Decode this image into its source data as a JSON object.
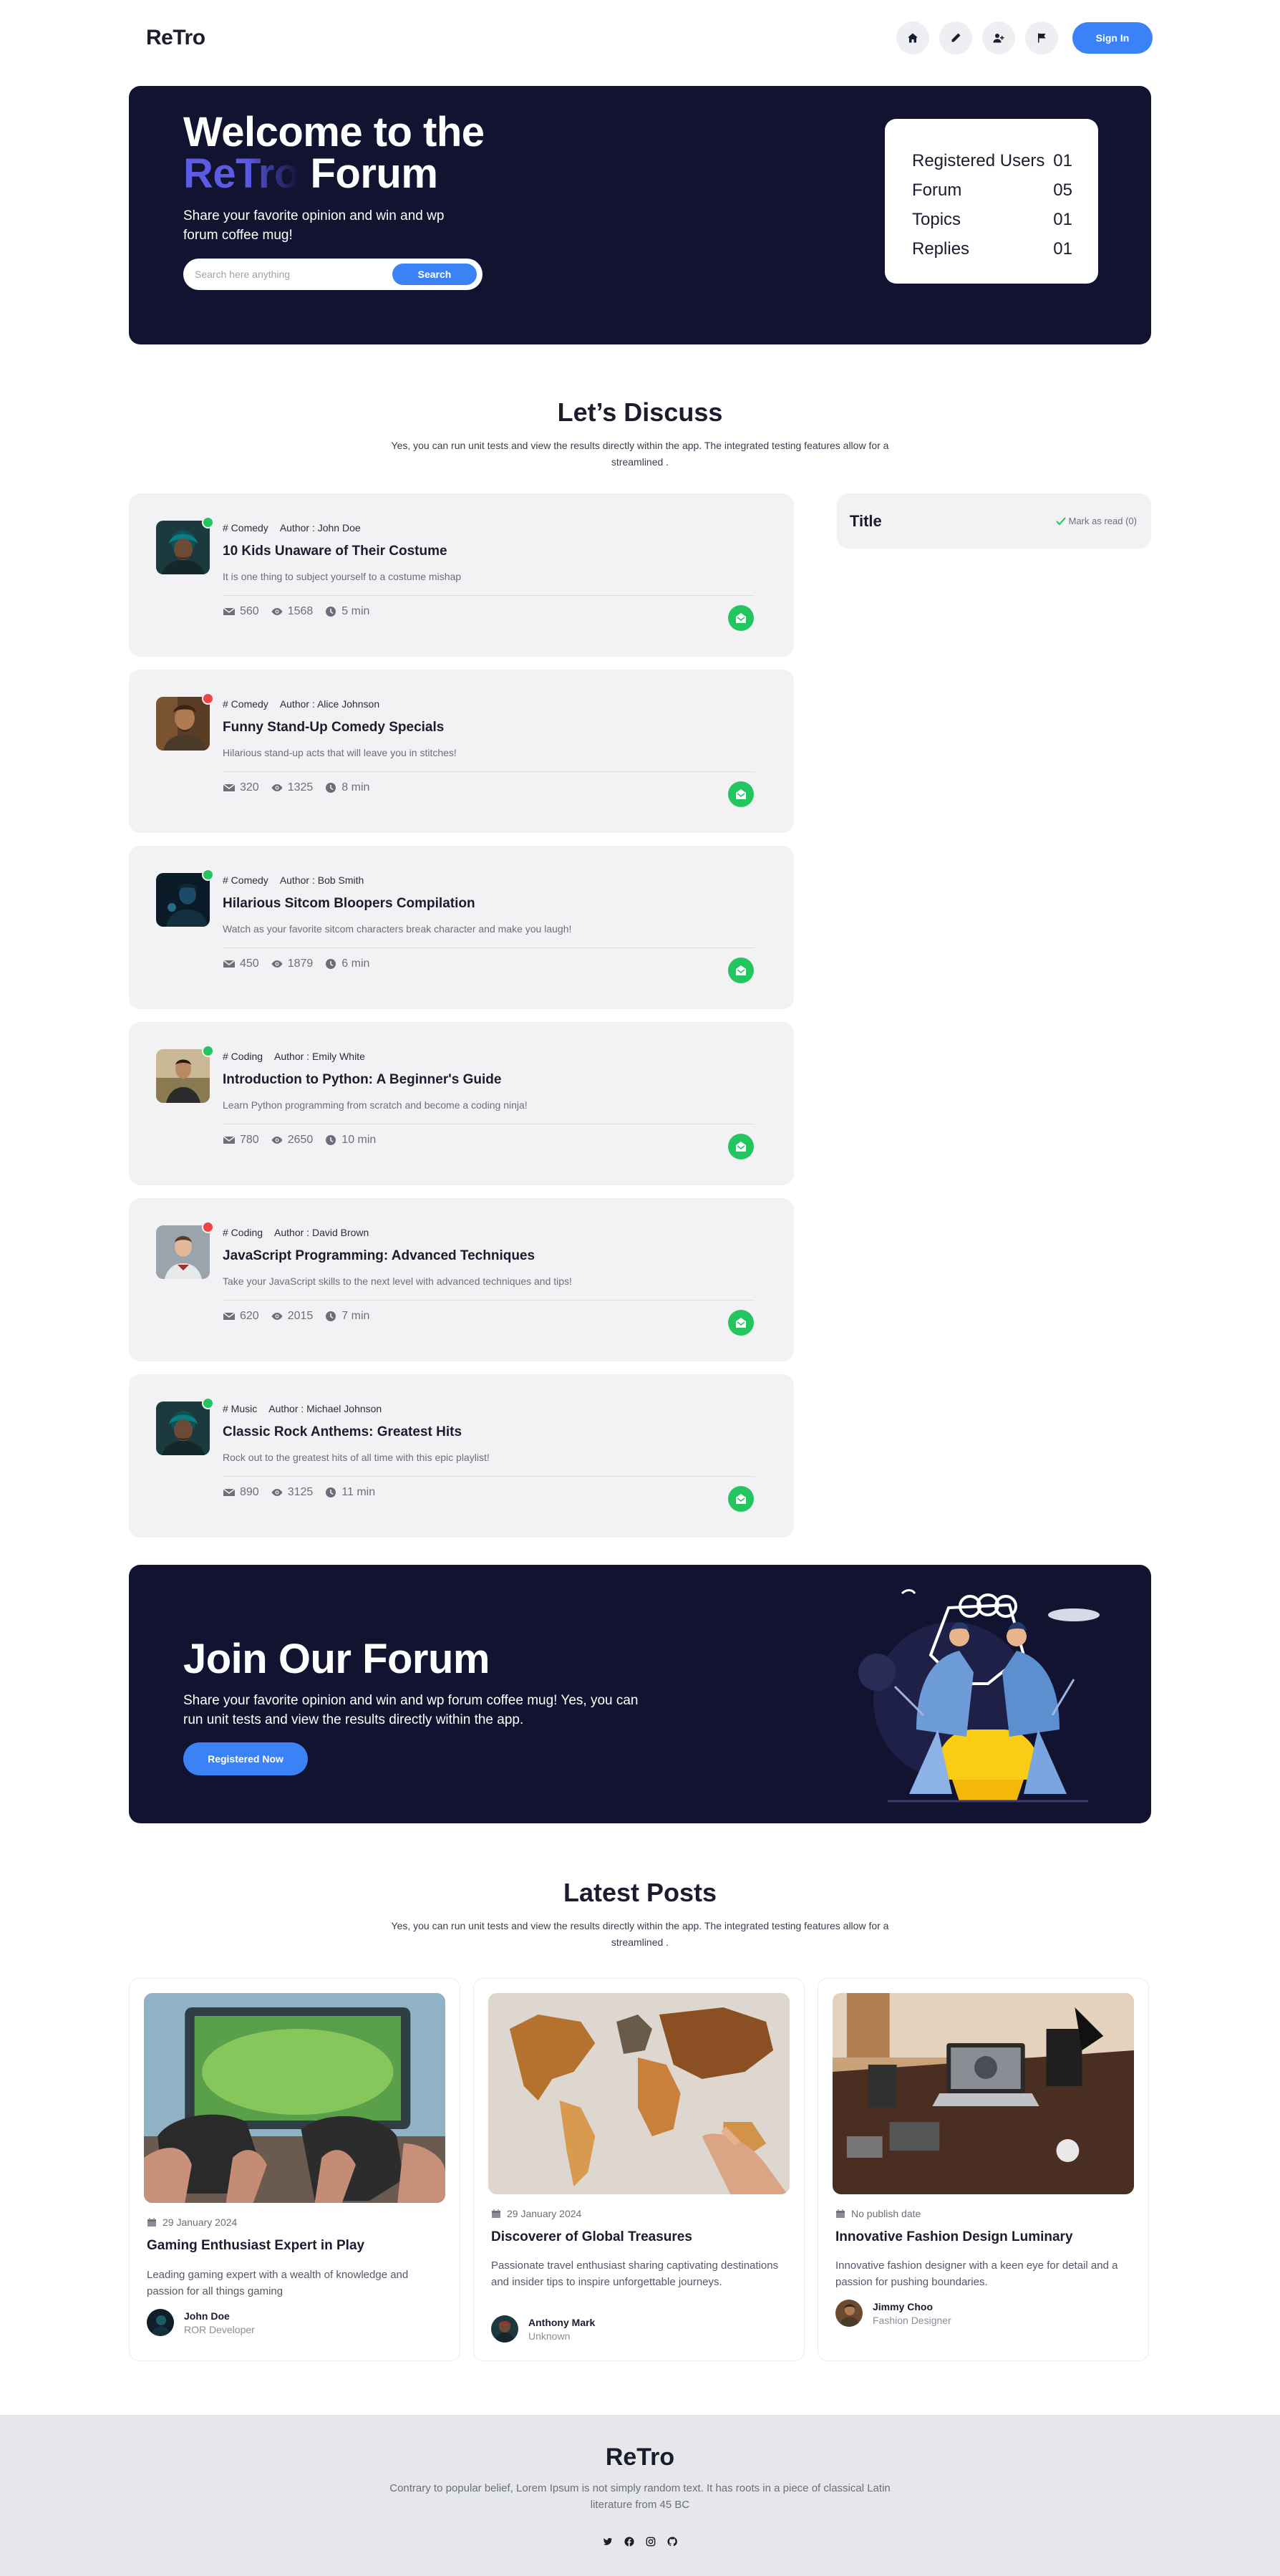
{
  "nav": {
    "brand": "ReTro",
    "icons": [
      "home-icon",
      "pencil-icon",
      "user-plus-icon",
      "flag-icon"
    ],
    "signin_label": "Sign In"
  },
  "hero": {
    "title_line1": "Welcome to the",
    "title_accent": "ReTro",
    "title_rest": " Forum",
    "subtitle": "Share your favorite opinion and win and wp forum coffee mug!",
    "search_placeholder": "Search here anything",
    "search_button": "Search",
    "stats": [
      {
        "label": "Registered Users",
        "value": "01"
      },
      {
        "label": "Forum",
        "value": "05"
      },
      {
        "label": "Topics",
        "value": "01"
      },
      {
        "label": "Replies",
        "value": "01"
      }
    ]
  },
  "discuss": {
    "title": "Let’s Discuss",
    "subtitle": "Yes, you can run unit tests and view the results directly within the app. The integrated testing features allow for a streamlined .",
    "topics": [
      {
        "tag": "# Comedy",
        "author": "Author : John Doe",
        "title": "10 Kids Unaware of Their Costume",
        "desc": "It is one thing to subject yourself to a costume mishap",
        "replies": "560",
        "views": "1568",
        "time": "5 min",
        "online": true
      },
      {
        "tag": "# Comedy",
        "author": "Author : Alice Johnson",
        "title": "Funny Stand-Up Comedy Specials",
        "desc": "Hilarious stand-up acts that will leave you in stitches!",
        "replies": "320",
        "views": "1325",
        "time": "8 min",
        "online": false
      },
      {
        "tag": "# Comedy",
        "author": "Author : Bob Smith",
        "title": "Hilarious Sitcom Bloopers Compilation",
        "desc": "Watch as your favorite sitcom characters break character and make you laugh!",
        "replies": "450",
        "views": "1879",
        "time": "6 min",
        "online": true
      },
      {
        "tag": "# Coding",
        "author": "Author : Emily White",
        "title": "Introduction to Python: A Beginner's Guide",
        "desc": "Learn Python programming from scratch and become a coding ninja!",
        "replies": "780",
        "views": "2650",
        "time": "10 min",
        "online": true
      },
      {
        "tag": "# Coding",
        "author": "Author : David Brown",
        "title": "JavaScript Programming: Advanced Techniques",
        "desc": "Take your JavaScript skills to the next level with advanced techniques and tips!",
        "replies": "620",
        "views": "2015",
        "time": "7 min",
        "online": false
      },
      {
        "tag": "# Music",
        "author": "Author : Michael Johnson",
        "title": "Classic Rock Anthems: Greatest Hits",
        "desc": "Rock out to the greatest hits of all time with this epic playlist!",
        "replies": "890",
        "views": "3125",
        "time": "11 min",
        "online": true
      }
    ],
    "side_title": "Title",
    "mark_read": "Mark as read (0)"
  },
  "join": {
    "title": "Join Our Forum",
    "subtitle": "Share your favorite opinion and win and wp forum coffee mug! Yes, you can run unit tests and view the results directly within the app.",
    "button": "Registered Now"
  },
  "latest": {
    "title": "Latest Posts",
    "subtitle": "Yes, you can run unit tests and view the results directly within the app. The integrated testing features allow for a streamlined .",
    "posts": [
      {
        "date": "29 January 2024",
        "title": "Gaming Enthusiast Expert in Play",
        "desc": "Leading gaming expert with a wealth of knowledge and passion for all things gaming",
        "author": "John Doe",
        "role": "ROR Developer"
      },
      {
        "date": "29 January 2024",
        "title": "Discoverer of Global Treasures",
        "desc": "Passionate travel enthusiast sharing captivating destinations and insider tips to inspire unforgettable journeys.",
        "author": "Anthony Mark",
        "role": "Unknown"
      },
      {
        "date": "No publish date",
        "title": "Innovative Fashion Design Luminary",
        "desc": "Innovative fashion designer with a keen eye for detail and a passion for pushing boundaries.",
        "author": "Jimmy Choo",
        "role": "Fashion Designer"
      }
    ]
  },
  "footer": {
    "brand": "ReTro",
    "subtitle": "Contrary to popular belief, Lorem Ipsum is not simply random text. It has roots in a piece of classical Latin literature from 45 BC",
    "socials": [
      "twitter-icon",
      "facebook-icon",
      "instagram-icon",
      "github-icon"
    ]
  },
  "colors": {
    "navy": "#121331",
    "accent_blue": "#3b82f6",
    "accent_purple": "#5b5be6",
    "online_green": "#22c55e",
    "offline_red": "#ef4444"
  }
}
